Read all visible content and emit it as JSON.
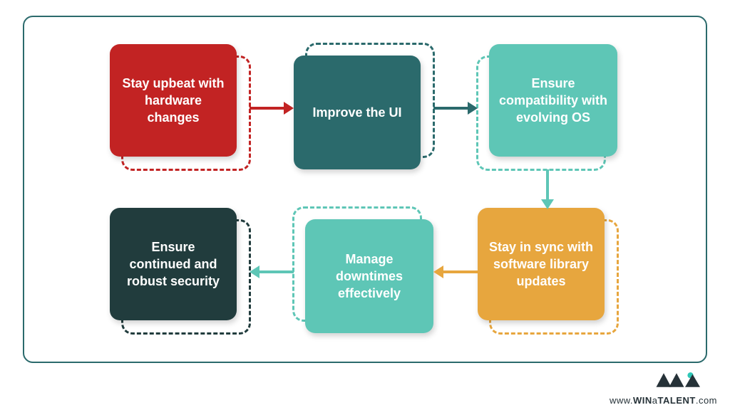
{
  "nodes": {
    "n1": {
      "label": "Stay upbeat with hardware changes",
      "color": "#c22323"
    },
    "n2": {
      "label": "Improve the UI",
      "color": "#2b6a6c"
    },
    "n3": {
      "label": "Ensure compatibility with evolving OS",
      "color": "#5ec6b6"
    },
    "n4": {
      "label": "Stay in sync with software library updates",
      "color": "#e7a63e"
    },
    "n5": {
      "label": "Manage downtimes effectively",
      "color": "#5ec6b6"
    },
    "n6": {
      "label": "Ensure continued and robust security",
      "color": "#213c3d"
    }
  },
  "flow_order": [
    "n1",
    "n2",
    "n3",
    "n4",
    "n5",
    "n6"
  ],
  "arrows": [
    {
      "from": "n1",
      "to": "n2",
      "dir": "right",
      "color": "#c22323"
    },
    {
      "from": "n2",
      "to": "n3",
      "dir": "right",
      "color": "#2b6a6c"
    },
    {
      "from": "n3",
      "to": "n4",
      "dir": "down",
      "color": "#5ec6b6"
    },
    {
      "from": "n4",
      "to": "n5",
      "dir": "left",
      "color": "#e7a63e"
    },
    {
      "from": "n5",
      "to": "n6",
      "dir": "left",
      "color": "#5ec6b6"
    }
  ],
  "brand": {
    "url_prefix": "www.",
    "url_part1": "WIN",
    "url_part2": "a",
    "url_part3": "TALENT",
    "url_suffix": ".com"
  }
}
